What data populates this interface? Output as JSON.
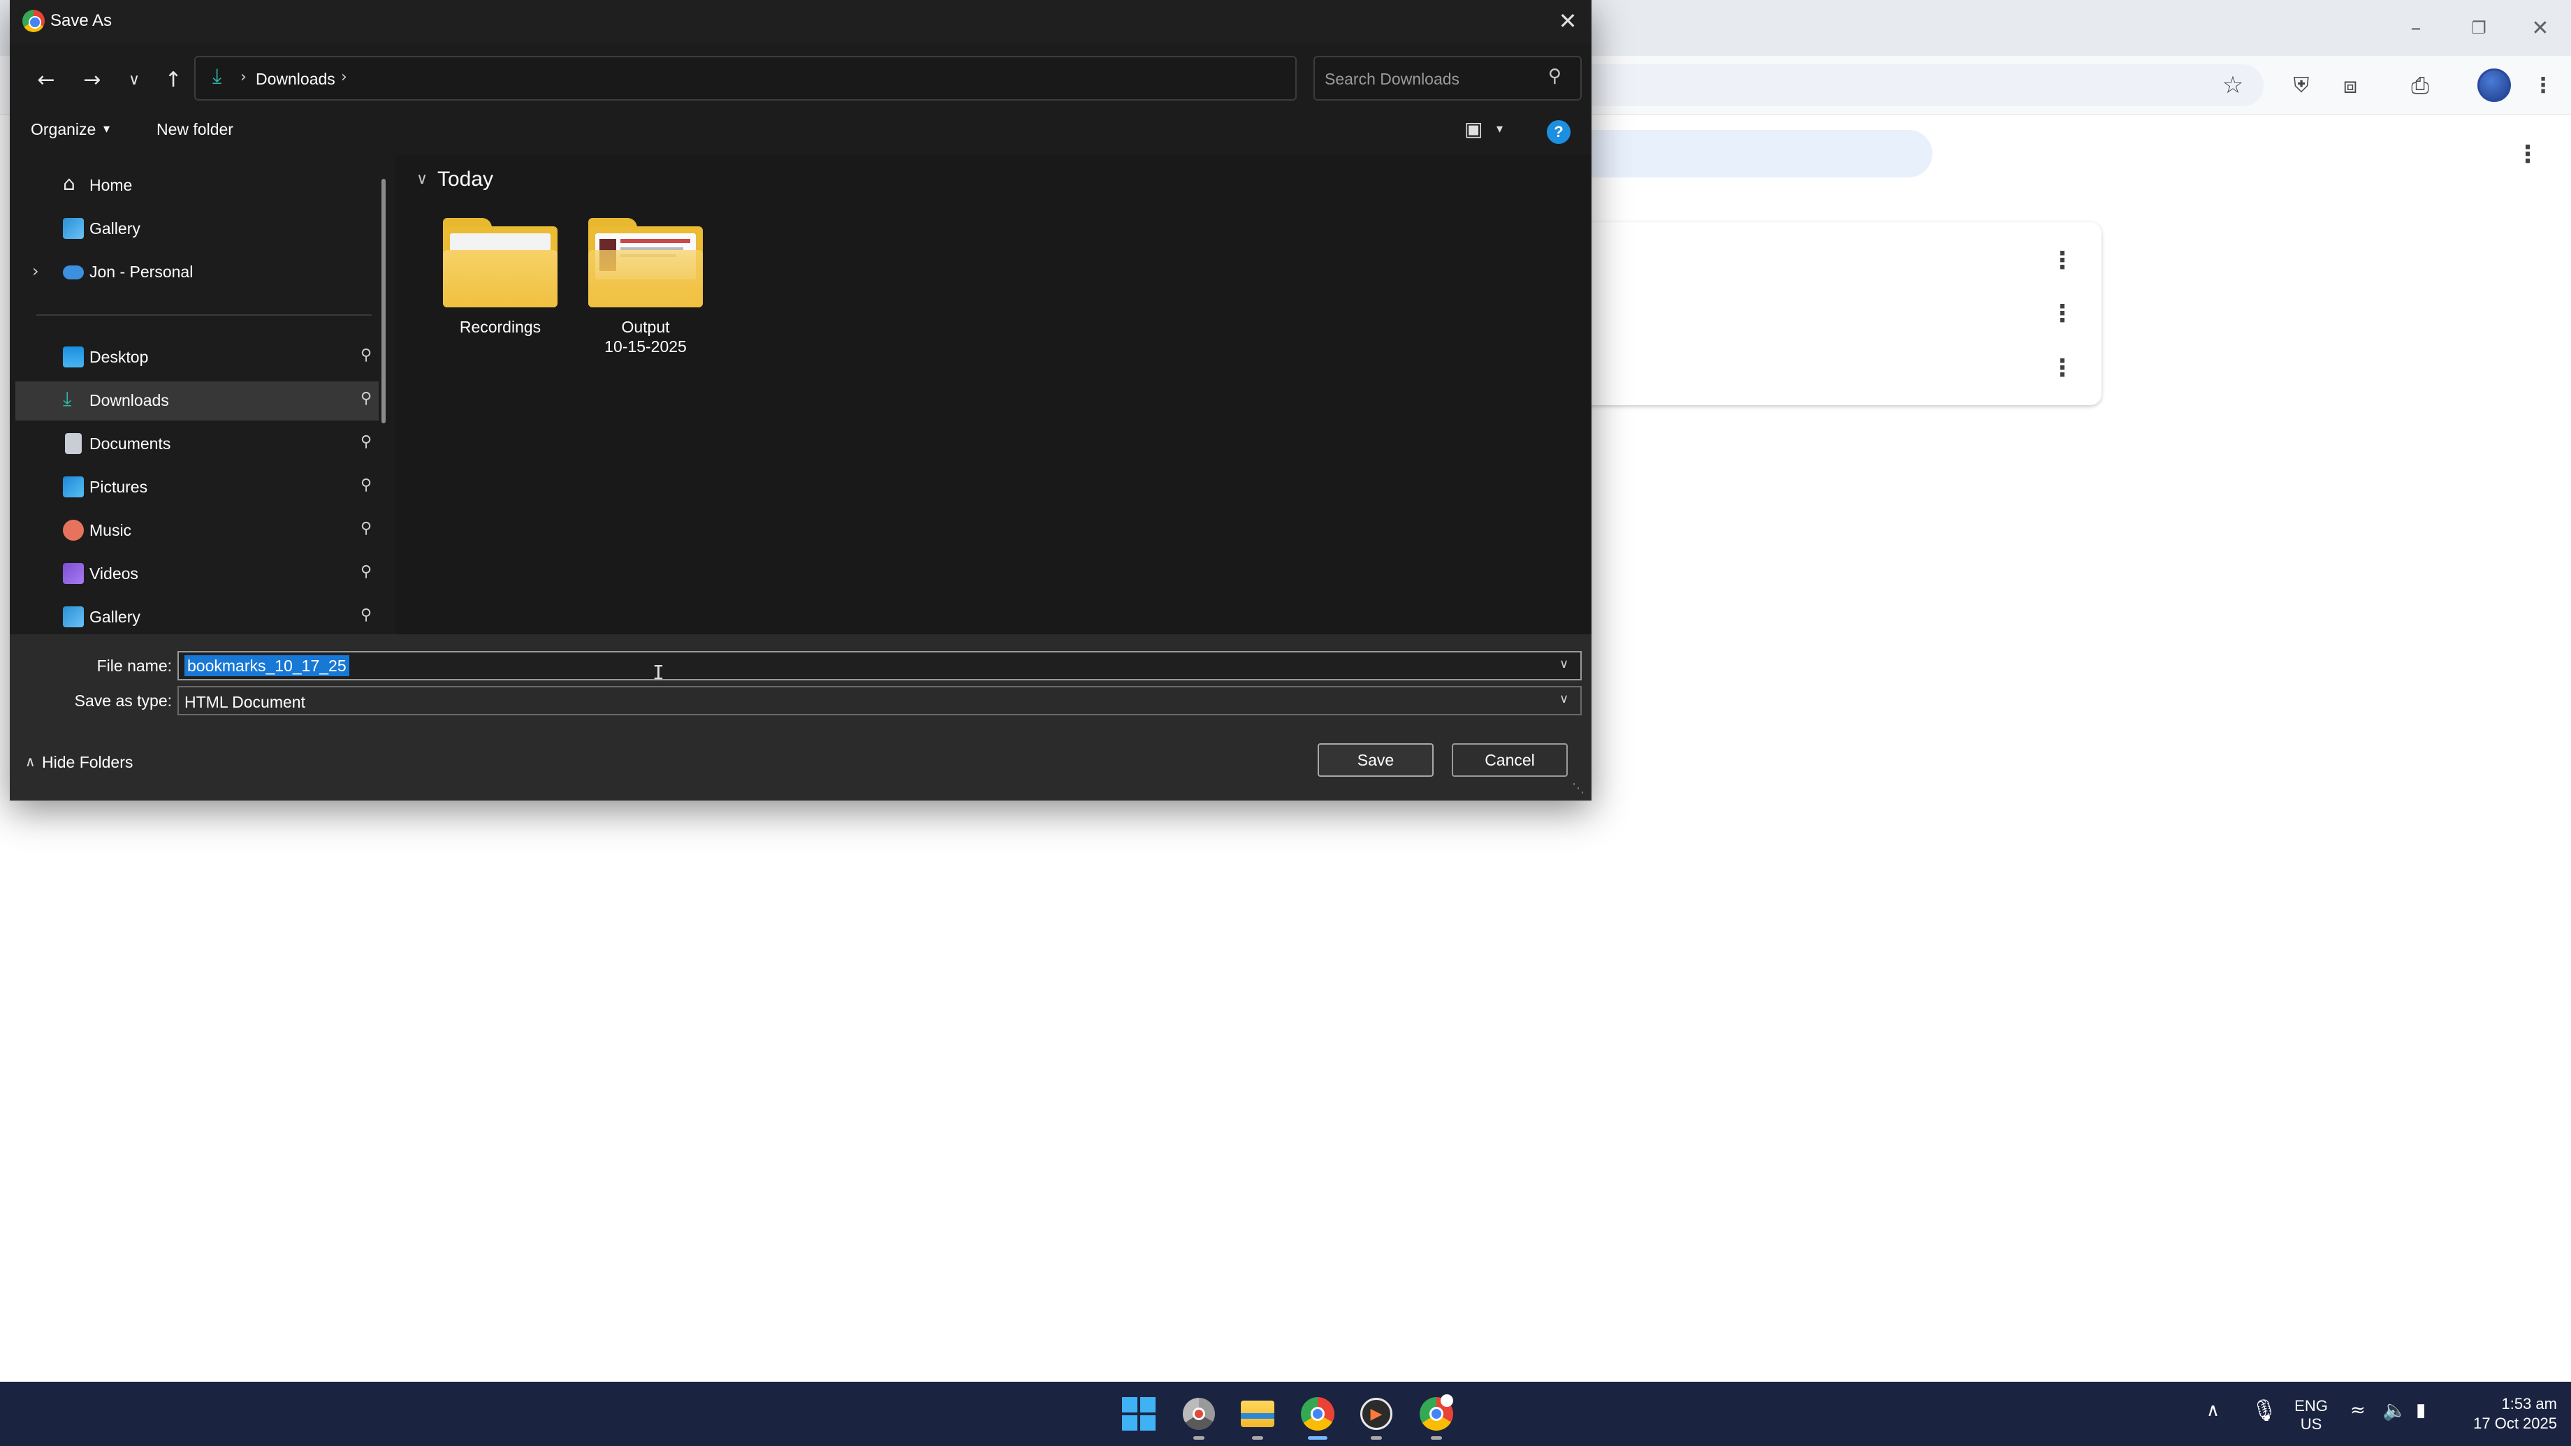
{
  "dialog": {
    "title": "Save As",
    "breadcrumb": [
      "Downloads"
    ],
    "search_placeholder": "Search Downloads",
    "commands": {
      "organize": "Organize",
      "new_folder": "New folder"
    },
    "nav_items": [
      {
        "label": "Home",
        "icon": "home-icon",
        "pinned": false
      },
      {
        "label": "Gallery",
        "icon": "gallery-icon",
        "pinned": false
      },
      {
        "label": "Jon - Personal",
        "icon": "cloud-icon",
        "pinned": false,
        "expandable": true
      },
      {
        "label": "Desktop",
        "icon": "desktop-icon",
        "pinned": true
      },
      {
        "label": "Downloads",
        "icon": "downloads-icon",
        "pinned": true,
        "selected": true
      },
      {
        "label": "Documents",
        "icon": "documents-icon",
        "pinned": true
      },
      {
        "label": "Pictures",
        "icon": "pictures-icon",
        "pinned": true
      },
      {
        "label": "Music",
        "icon": "music-icon",
        "pinned": true
      },
      {
        "label": "Videos",
        "icon": "videos-icon",
        "pinned": true
      },
      {
        "label": "Gallery",
        "icon": "gallery-icon",
        "pinned": true
      }
    ],
    "group_label": "Today",
    "folders": [
      {
        "name": "Recordings"
      },
      {
        "name_line1": "Output",
        "name_line2": "10-15-2025"
      }
    ],
    "file_name_label": "File name:",
    "file_name_value": "bookmarks_10_17_25",
    "save_type_label": "Save as type:",
    "save_type_value": "HTML Document",
    "hide_folders": "Hide Folders",
    "save_button": "Save",
    "cancel_button": "Cancel"
  },
  "taskbar": {
    "apps": [
      "start-icon",
      "chrome-dev-icon",
      "file-explorer-icon",
      "chrome-icon",
      "media-player-icon",
      "chrome-canary-icon"
    ],
    "language": "ENG",
    "region": "US",
    "time": "1:53 am",
    "date": "17 Oct 2025"
  },
  "colors": {
    "dialog_bg": "#1c1c1c",
    "selection_blue": "#1778d6",
    "taskbar_bg": "#1a2340",
    "folder_yellow": "#f0c040",
    "downloads_teal": "#2fb5a5"
  }
}
